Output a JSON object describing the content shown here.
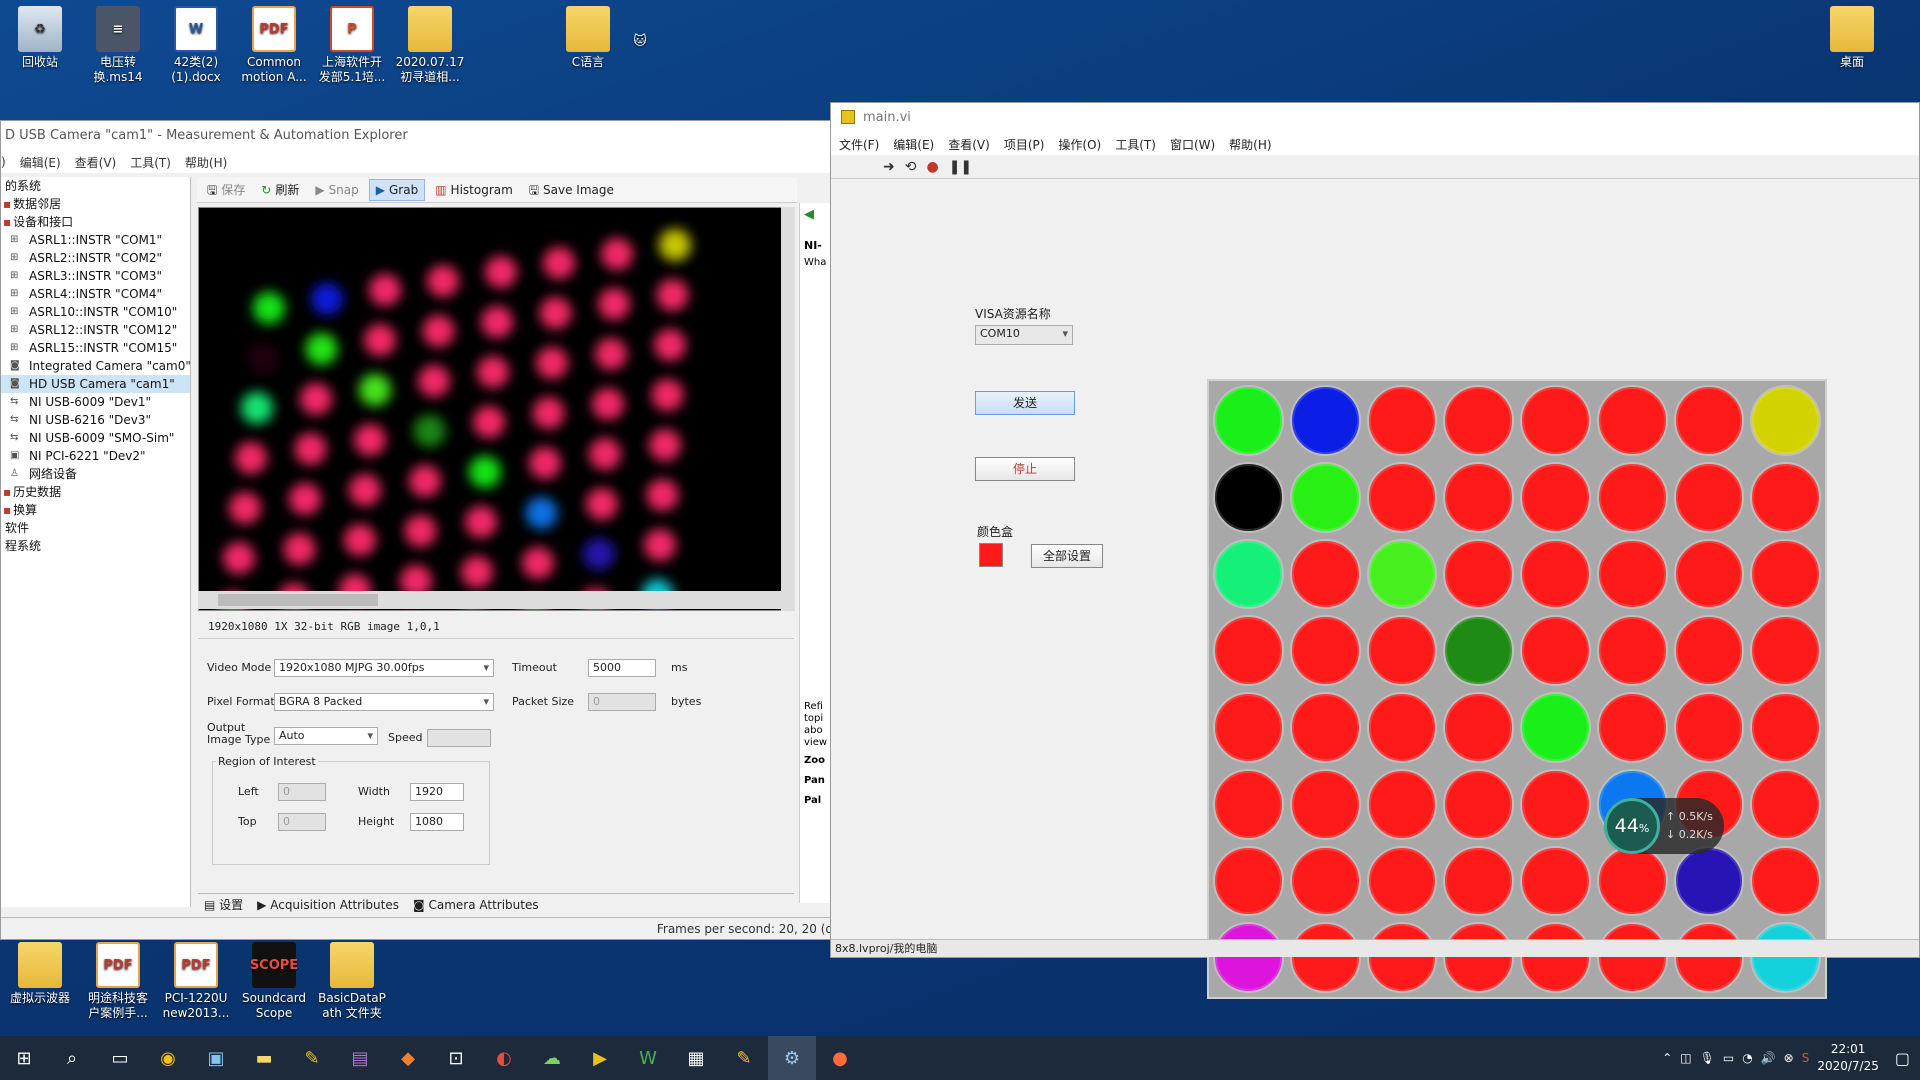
{
  "desktop": {
    "icons": [
      {
        "name": "recycle-bin",
        "label": "回收站",
        "kind": "bin",
        "glyph": "♻"
      },
      {
        "name": "voltage-file",
        "label": "电压转\n换.ms14",
        "kind": "gray",
        "glyph": "≡"
      },
      {
        "name": "word-doc",
        "label": "42类(2)\n(1).docx",
        "kind": "word",
        "glyph": "W"
      },
      {
        "name": "pdf-common",
        "label": "Common\nmotion A...",
        "kind": "pdf",
        "glyph": "PDF"
      },
      {
        "name": "ppt-file",
        "label": "上海软件开\n发部5.1培...",
        "kind": "ppt",
        "glyph": "P"
      },
      {
        "name": "folder-2020",
        "label": "2020.07.17\n初寻道相...",
        "kind": "folder",
        "glyph": ""
      },
      {
        "name": "folder-c",
        "label": "C语言",
        "kind": "folder",
        "glyph": ""
      },
      {
        "name": "cat-widget",
        "label": "",
        "kind": "cat",
        "glyph": "🐱"
      },
      {
        "name": "folder-desktop",
        "label": "桌面",
        "kind": "folder",
        "glyph": ""
      },
      {
        "name": "folder-oscilloscope",
        "label": "虚拟示波器",
        "kind": "folder",
        "glyph": ""
      },
      {
        "name": "pdf-mingtu",
        "label": "明途科技客\n户案例手...",
        "kind": "pdf",
        "glyph": "PDF"
      },
      {
        "name": "pdf-pci",
        "label": "PCI-1220U\nnew2013...",
        "kind": "pdf",
        "glyph": "PDF"
      },
      {
        "name": "soundcard-scope",
        "label": "Soundcard\nScope",
        "kind": "scope",
        "glyph": "SCOPE"
      },
      {
        "name": "folder-basic",
        "label": "BasicDataP\nath 文件夹",
        "kind": "folder",
        "glyph": ""
      }
    ]
  },
  "max": {
    "title": "D USB Camera  \"cam1\" - Measurement & Automation Explorer",
    "menu": [
      ")",
      "编辑(E)",
      "查看(V)",
      "工具(T)",
      "帮助(H)"
    ],
    "tree": [
      {
        "label": "的系统",
        "top": true,
        "icon": ""
      },
      {
        "label": "数据邻居",
        "top": true,
        "icon": "▪"
      },
      {
        "label": "设备和接口",
        "top": true,
        "icon": "▪"
      },
      {
        "label": "ASRL1::INSTR \"COM1\"",
        "icon": "⊞"
      },
      {
        "label": "ASRL2::INSTR \"COM2\"",
        "icon": "⊞"
      },
      {
        "label": "ASRL3::INSTR \"COM3\"",
        "icon": "⊞"
      },
      {
        "label": "ASRL4::INSTR \"COM4\"",
        "icon": "⊞"
      },
      {
        "label": "ASRL10::INSTR \"COM10\"",
        "icon": "⊞"
      },
      {
        "label": "ASRL12::INSTR \"COM12\"",
        "icon": "⊞"
      },
      {
        "label": "ASRL15::INSTR \"COM15\"",
        "icon": "⊞"
      },
      {
        "label": "Integrated Camera  \"cam0\"",
        "icon": "◙"
      },
      {
        "label": "HD USB Camera  \"cam1\"",
        "icon": "◙",
        "sel": true
      },
      {
        "label": "NI USB-6009 \"Dev1\"",
        "icon": "⇆"
      },
      {
        "label": "NI USB-6216 \"Dev3\"",
        "icon": "⇆"
      },
      {
        "label": "NI USB-6009 \"SMO-Sim\"",
        "icon": "⇆"
      },
      {
        "label": "NI PCI-6221 \"Dev2\"",
        "icon": "▣"
      },
      {
        "label": "网络设备",
        "icon": "♙"
      },
      {
        "label": "历史数据",
        "top": true,
        "icon": "▪"
      },
      {
        "label": "换算",
        "top": true,
        "icon": "▪"
      },
      {
        "label": "软件",
        "top": true,
        "icon": ""
      },
      {
        "label": "程系统",
        "top": true,
        "icon": ""
      }
    ],
    "toolbar": {
      "save": "保存",
      "refresh": "刷新",
      "snap": "Snap",
      "grab": "Grab",
      "histogram": "Histogram",
      "save_image": "Save Image"
    },
    "info": "1920x1080   1X   32-bit RGB image   1,0,1",
    "settings": {
      "video_mode_label": "Video Mode",
      "video_mode": "1920x1080 MJPG 30.00fps",
      "pixel_format_label": "Pixel Format",
      "pixel_format": "BGRA 8 Packed",
      "output_label_1": "Output",
      "output_label_2": "Image Type",
      "output_type": "Auto",
      "timeout_label": "Timeout",
      "timeout": "5000",
      "timeout_unit": "ms",
      "packet_label": "Packet Size",
      "packet": "0",
      "packet_unit": "bytes",
      "speed_label": "Speed",
      "roi_label": "Region of Interest",
      "left_label": "Left",
      "left": "0",
      "top_label": "Top",
      "top": "0",
      "width_label": "Width",
      "width": "1920",
      "height_label": "Height",
      "height": "1080"
    },
    "tabs": {
      "settings": "设置",
      "acq": "Acquisition Attributes",
      "cam": "Camera Attributes"
    },
    "status": "Frames per second: 20, 20 (d",
    "side": {
      "ni": "NI-",
      "wha": "Wha",
      "ref": "Refi\ntopi\nabo\nview",
      "zoo": "Zoo",
      "pan": "Pan",
      "pal": "Pal"
    }
  },
  "lv": {
    "title": "main.vi",
    "menu": [
      "文件(F)",
      "编辑(E)",
      "查看(V)",
      "项目(P)",
      "操作(O)",
      "工具(T)",
      "窗口(W)",
      "帮助(H)"
    ],
    "visa_label": "VISA资源名称",
    "visa_value": "COM10",
    "send": "发送",
    "stop": "停止",
    "color_box_label": "颜色盒",
    "set_all": "全部设置",
    "color_box": "#ff1a1a",
    "grid": [
      [
        "#19f019",
        "#0a1ee6",
        "#ff1a1a",
        "#ff1a1a",
        "#ff1a1a",
        "#ff1a1a",
        "#ff1a1a",
        "#d2d200"
      ],
      [
        "#000000",
        "#28f014",
        "#ff1a1a",
        "#ff1a1a",
        "#ff1a1a",
        "#ff1a1a",
        "#ff1a1a",
        "#ff1a1a"
      ],
      [
        "#14f078",
        "#ff1a1a",
        "#46f01e",
        "#ff1a1a",
        "#ff1a1a",
        "#ff1a1a",
        "#ff1a1a",
        "#ff1a1a"
      ],
      [
        "#ff1a1a",
        "#ff1a1a",
        "#ff1a1a",
        "#1e8c14",
        "#ff1a1a",
        "#ff1a1a",
        "#ff1a1a",
        "#ff1a1a"
      ],
      [
        "#ff1a1a",
        "#ff1a1a",
        "#ff1a1a",
        "#ff1a1a",
        "#19f019",
        "#ff1a1a",
        "#ff1a1a",
        "#ff1a1a"
      ],
      [
        "#ff1a1a",
        "#ff1a1a",
        "#ff1a1a",
        "#ff1a1a",
        "#ff1a1a",
        "#0a78f0",
        "#ff1a1a",
        "#ff1a1a"
      ],
      [
        "#ff1a1a",
        "#ff1a1a",
        "#ff1a1a",
        "#ff1a1a",
        "#ff1a1a",
        "#ff1a1a",
        "#2814b4",
        "#ff1a1a"
      ],
      [
        "#dc14dc",
        "#ff1a1a",
        "#ff1a1a",
        "#ff1a1a",
        "#ff1a1a",
        "#ff1a1a",
        "#ff1a1a",
        "#14d2dc"
      ]
    ],
    "project": "8x8.lvproj/我的电脑"
  },
  "netwidget": {
    "pct": "44",
    "pct_unit": "%",
    "up": "0.5K/s",
    "down": "0.2K/s"
  },
  "taskbar": {
    "time": "22:01",
    "date": "2020/7/25"
  }
}
